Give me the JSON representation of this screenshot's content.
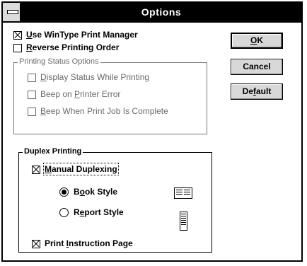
{
  "window": {
    "title": "Options"
  },
  "main_options": [
    {
      "prefix": "",
      "accel": "U",
      "rest": "se WinType Print Manager",
      "checked": true
    },
    {
      "prefix": "",
      "accel": "R",
      "rest": "everse Printing Order",
      "checked": false
    }
  ],
  "printing_status": {
    "title": "Printing Status Options",
    "items": [
      {
        "prefix": "",
        "accel": "D",
        "rest": "isplay Status While Printing",
        "checked": false
      },
      {
        "prefix": "Beep on ",
        "accel": "P",
        "rest": "rinter Error",
        "checked": false
      },
      {
        "prefix": "",
        "accel": "B",
        "rest": "eep When Print Job Is Complete",
        "checked": false
      }
    ]
  },
  "duplex": {
    "title": "Duplex Printing",
    "manual": {
      "prefix": "",
      "accel": "M",
      "rest": "anual Duplexing",
      "checked": true
    },
    "book": {
      "prefix": "B",
      "accel": "o",
      "rest": "ok Style",
      "selected": true
    },
    "report": {
      "prefix": "R",
      "accel": "e",
      "rest": "port Style",
      "selected": false
    },
    "instruction": {
      "prefix": "Print ",
      "accel": "I",
      "rest": "nstruction Page",
      "checked": true
    }
  },
  "buttons": {
    "ok": {
      "prefix": "",
      "accel": "O",
      "rest": "K"
    },
    "cancel": {
      "prefix": "Cancel",
      "accel": "",
      "rest": ""
    },
    "default": {
      "prefix": "De",
      "accel": "f",
      "rest": "ault"
    }
  }
}
